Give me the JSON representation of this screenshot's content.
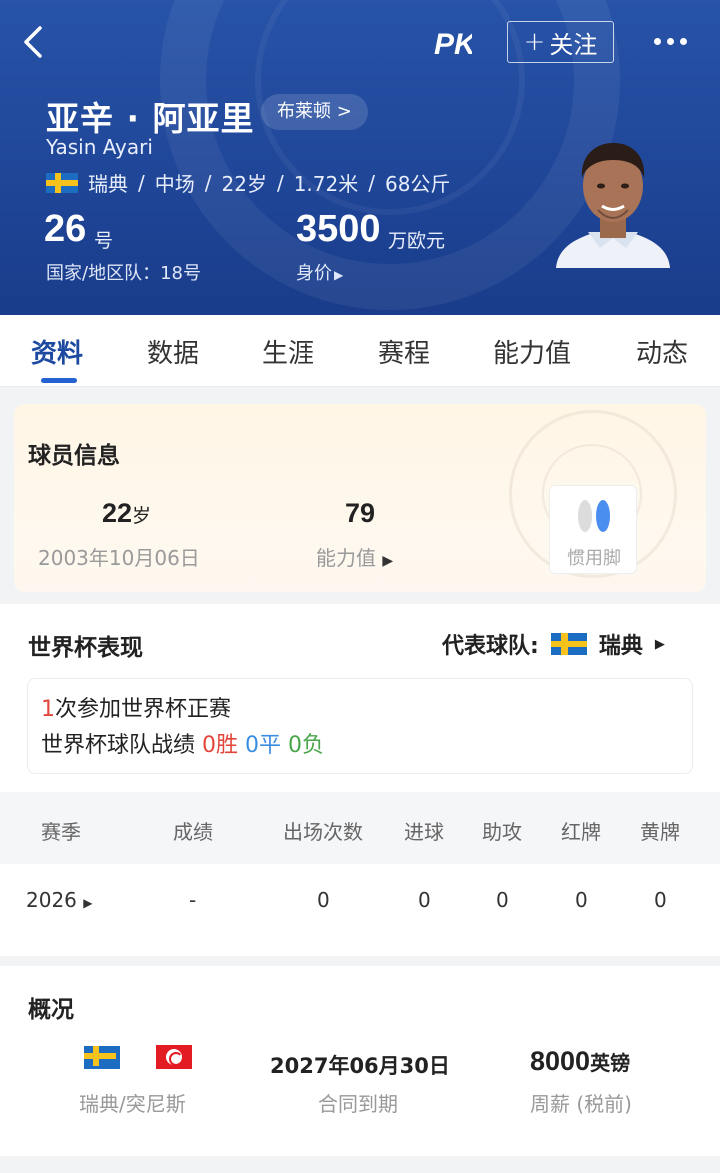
{
  "header": {
    "follow_label": "关注",
    "name_cn": "亚辛 · 阿亚里",
    "club": "布莱顿 >",
    "name_en": "Yasin Ayari",
    "nationality": "瑞典",
    "position": "中场",
    "age": "22岁",
    "height": "1.72米",
    "weight": "68公斤",
    "shirt_number": "26",
    "shirt_unit": "号",
    "national_number": "国家/地区队：18号",
    "market_value": "3500",
    "market_value_unit": "万欧元",
    "market_value_label": "身价"
  },
  "tabs": [
    "资料",
    "数据",
    "生涯",
    "赛程",
    "能力值",
    "动态"
  ],
  "player_info": {
    "title": "球员信息",
    "age_value": "22",
    "age_unit": "岁",
    "birthdate": "2003年10月06日",
    "rating_value": "79",
    "rating_label": "能力值",
    "foot_label": "惯用脚"
  },
  "world_cup": {
    "title": "世界杯表现",
    "represent_label": "代表球队:",
    "represent_team": "瑞典",
    "appearances_count": "1",
    "appearances_text": "次参加世界杯正赛",
    "record_label": "世界杯球队战绩",
    "wins": "0胜",
    "draws": "0平",
    "losses": "0负",
    "columns": [
      "赛季",
      "成绩",
      "出场次数",
      "进球",
      "助攻",
      "红牌",
      "黄牌"
    ],
    "rows": [
      {
        "season": "2026",
        "result": "-",
        "apps": "0",
        "goals": "0",
        "assists": "0",
        "red": "0",
        "yellow": "0"
      }
    ]
  },
  "overview": {
    "title": "概况",
    "nationality": "瑞典/突尼斯",
    "contract_date": "2027年06月30日",
    "contract_label": "合同到期",
    "wage_value": "8000",
    "wage_currency": "英镑",
    "wage_label": "周薪 (税前)"
  },
  "colors": {
    "header_bg": "#1f4597",
    "accent": "#2462d1",
    "win": "#e2463b",
    "draw": "#3b8de0",
    "loss": "#49a54a"
  },
  "icons": [
    "back-arrow-icon",
    "pk-logo-icon",
    "more-dots-icon",
    "sweden-flag-icon",
    "tunisia-flag-icon",
    "foot-icon"
  ]
}
